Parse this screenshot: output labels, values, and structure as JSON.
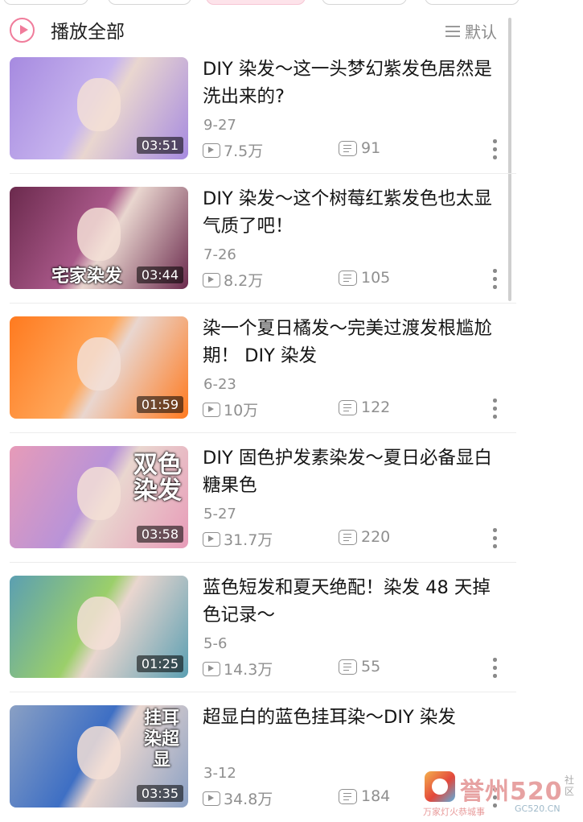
{
  "header": {
    "play_all_label": "播放全部",
    "sort_label": "默认"
  },
  "videos": [
    {
      "title": "DIY 染发～这一头梦幻紫发色居然是洗出来的?",
      "date": "9-27",
      "views": "7.5万",
      "comments": "91",
      "duration": "03:51",
      "thumb_colors": [
        "#a68ae0",
        "#c7b4ee"
      ]
    },
    {
      "title": "DIY 染发～这个树莓红紫发色也太显气质了吧！",
      "date": "7-26",
      "views": "8.2万",
      "comments": "105",
      "duration": "03:44",
      "overlay": "宅家染发",
      "thumb_colors": [
        "#6b2a4d",
        "#a95889"
      ]
    },
    {
      "title": "染一个夏日橘发～完美过渡发根尴尬期！ DIY 染发",
      "date": "6-23",
      "views": "10万",
      "comments": "122",
      "duration": "01:59",
      "thumb_colors": [
        "#ff7a1f",
        "#ffa75a"
      ]
    },
    {
      "title": "DIY 固色护发素染发～夏日必备显白糖果色",
      "date": "5-27",
      "views": "31.7万",
      "comments": "220",
      "duration": "03:58",
      "overlay": "双色染发",
      "thumb_colors": [
        "#e79bb8",
        "#b993d8"
      ]
    },
    {
      "title": "蓝色短发和夏天绝配！染发 48 天掉色记录～",
      "date": "5-6",
      "views": "14.3万",
      "comments": "55",
      "duration": "01:25",
      "thumb_colors": [
        "#5b9fb2",
        "#9bcf6a"
      ]
    },
    {
      "title": "超显白的蓝色挂耳染～DIY 染发",
      "date": "3-12",
      "views": "34.8万",
      "comments": "184",
      "duration": "03:35",
      "overlay": "挂耳染超显",
      "thumb_colors": [
        "#8aa0c4",
        "#3e6fc4"
      ]
    }
  ],
  "watermark": {
    "text": "誉州520",
    "sub": "万家灯火恭城事",
    "site": "GC520.CN",
    "side": "社区"
  },
  "colors": {
    "accent": "#f07c9b",
    "muted": "#8f8f8f"
  }
}
